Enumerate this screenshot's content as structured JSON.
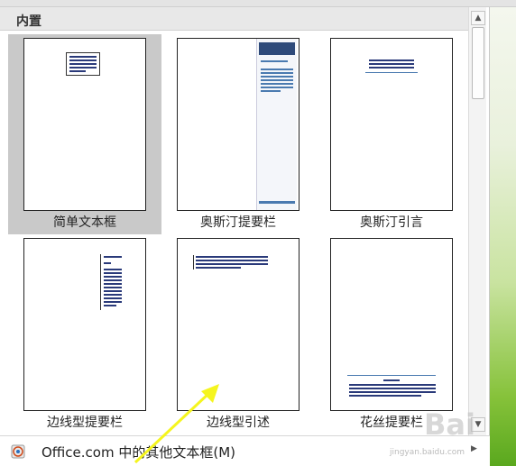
{
  "header": {
    "title": "内置"
  },
  "gallery": {
    "items": [
      {
        "label": "简单文本框"
      },
      {
        "label": "奥斯汀提要栏"
      },
      {
        "label": "奥斯汀引言"
      },
      {
        "label": "边线型提要栏"
      },
      {
        "label": "边线型引述"
      },
      {
        "label": "花丝提要栏"
      }
    ]
  },
  "footer": {
    "label": "Office.com 中的其他文本框(M)"
  },
  "watermark": {
    "text": "jingyan.baidu.com"
  },
  "colors": {
    "accent_blue": "#2e4a7a",
    "selected_bg": "#c9c9c9",
    "arrow": "#f5f51e"
  },
  "icons": {
    "scroll_up": "triangle-up",
    "scroll_down": "triangle-down",
    "footer": "office-globe",
    "submenu": "triangle-right"
  }
}
